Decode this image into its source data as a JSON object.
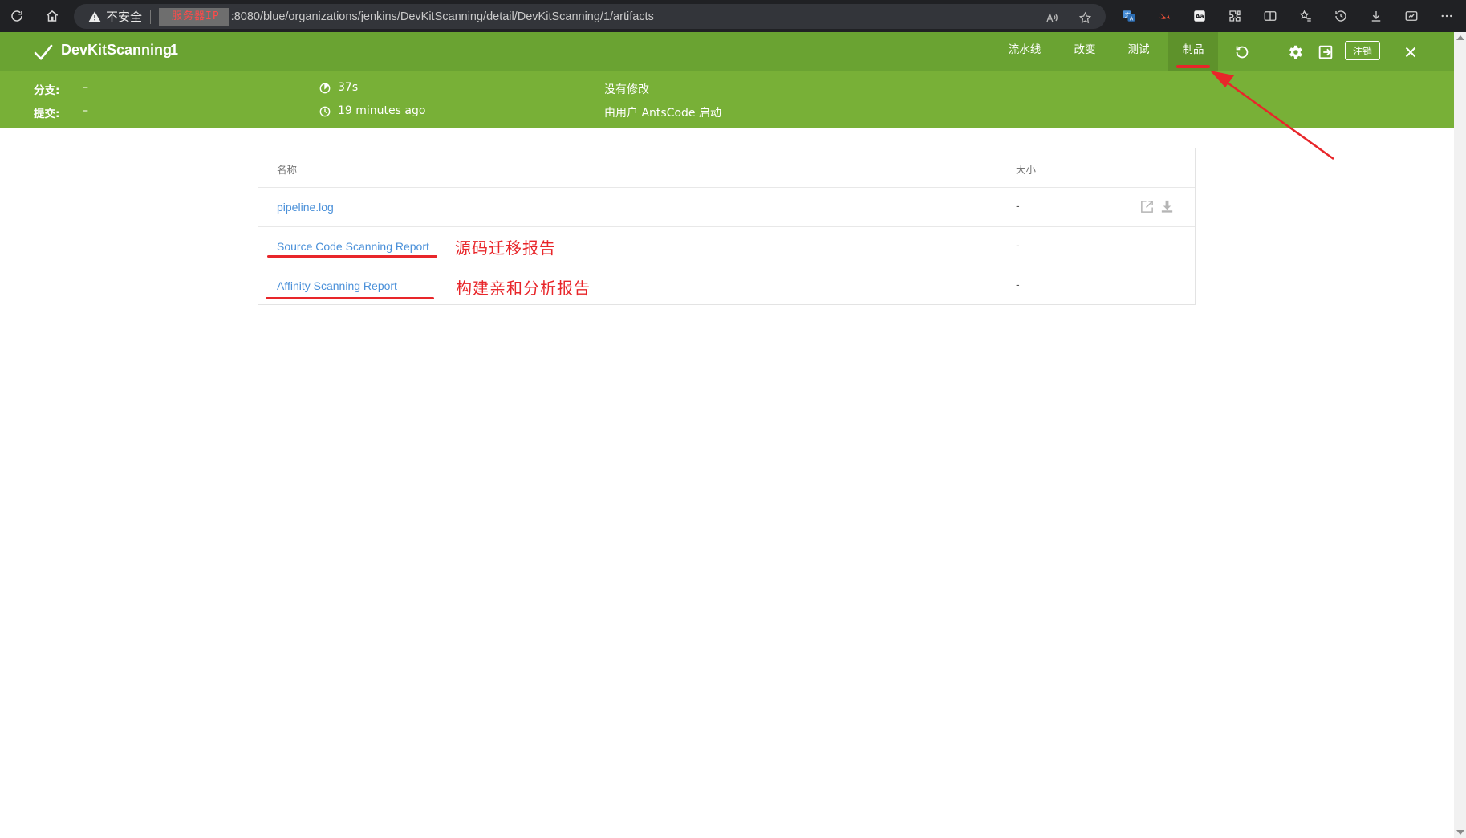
{
  "browser": {
    "security_label": "不安全",
    "masked_host": "服务器IP",
    "url": ":8080/blue/organizations/jenkins/DevKitScanning/detail/DevKitScanning/1/artifacts"
  },
  "run": {
    "title": "DevKitScanning",
    "number": "1",
    "tabs": [
      {
        "label": "流水线"
      },
      {
        "label": "改变"
      },
      {
        "label": "测试"
      },
      {
        "label": "制品"
      }
    ],
    "active_tab": "制品",
    "logout_label": "注销",
    "meta": {
      "branch_label": "分支:",
      "branch_value": "–",
      "commit_label": "提交:",
      "commit_value": "–",
      "duration": "37s",
      "started": "19 minutes ago",
      "changes": "没有修改",
      "cause": "由用户 AntsCode 启动"
    }
  },
  "artifacts": {
    "columns": {
      "name": "名称",
      "size": "大小"
    },
    "rows": [
      {
        "name": "pipeline.log",
        "size": "-"
      },
      {
        "name": "Source Code Scanning Report",
        "size": "-"
      },
      {
        "name": "Affinity Scanning Report",
        "size": "-"
      }
    ]
  },
  "annotations": {
    "source_report_note": "源码迁移报告",
    "affinity_report_note": "构建亲和分析报告"
  },
  "colors": {
    "header_green": "#78b037",
    "title_bar_green": "#6aa332",
    "active_tab": "#5e922b",
    "link_blue": "#4a90d9",
    "annotation_red": "#e8262a"
  },
  "icons": {
    "reload": "reload-icon",
    "home": "home-icon",
    "warning": "warning-icon",
    "status": "check-icon",
    "rerun": "rerun-icon",
    "settings": "gear-icon",
    "exit": "exit-icon",
    "close": "close-icon",
    "open": "external-link-icon",
    "download": "download-icon"
  }
}
